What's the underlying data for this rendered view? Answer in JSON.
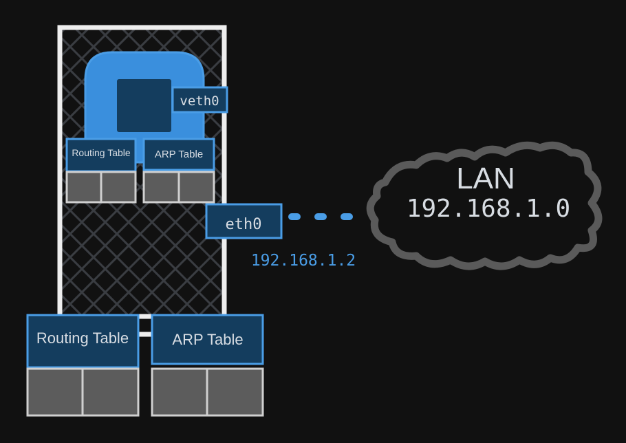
{
  "colors": {
    "background": "#111111",
    "accent": "#4a9de6",
    "box_fill": "#143d5e",
    "cell_fill": "#5c5c5c",
    "cloud_stroke": "#5a5a5a",
    "text": "#d8dde3"
  },
  "namespace": {
    "interface": "veth0",
    "routing_table": "Routing Table",
    "arp_table": "ARP Table"
  },
  "host": {
    "interface": "eth0",
    "ip": "192.168.1.2",
    "routing_table": "Routing Table",
    "arp_table": "ARP Table"
  },
  "network": {
    "name": "LAN",
    "subnet": "192.168.1.0"
  }
}
